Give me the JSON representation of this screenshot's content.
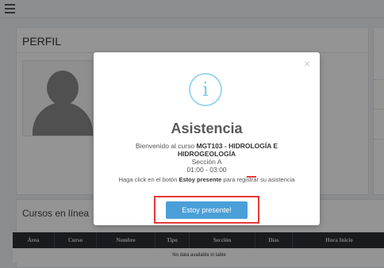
{
  "page": {
    "title": "PERFIL"
  },
  "cursos": {
    "title": "Cursos en línea",
    "columns": [
      "Área",
      "Curso",
      "Nombre",
      "Tipo",
      "Sección",
      "Días",
      "Hora Inicio"
    ],
    "empty_text": "No data available in table"
  },
  "modal": {
    "icon": "info-icon",
    "close_label": "×",
    "title": "Asistencia",
    "line1_prefix": "Bienvenido al curso ",
    "course_part1": "MGT103 - HIDROLOGÍA E",
    "course_part2": "HIDROGEOLOGÍA",
    "section": "Sección A",
    "time": "01:00 - 03:00",
    "instr_prefix": "Haga click en el botón ",
    "instr_strong": "Estoy presente",
    "instr_suffix": " para registrar su asistencia",
    "button_label": "Estoy presente!"
  },
  "colors": {
    "accent_button": "#4a9fd8",
    "info_icon": "#7fcae9",
    "highlight": "#e53935"
  }
}
